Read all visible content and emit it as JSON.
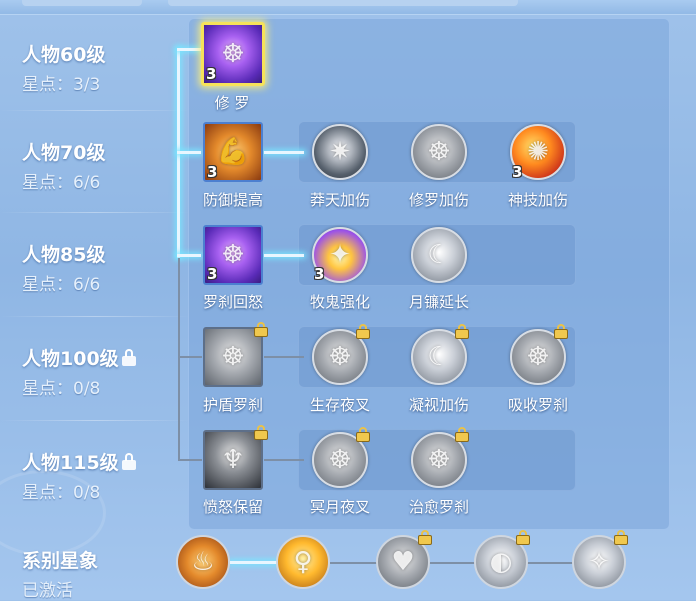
{
  "levels": [
    {
      "title": "人物60级",
      "stars": "星点：3/3",
      "locked": false
    },
    {
      "title": "人物70级",
      "stars": "星点：6/6",
      "locked": false
    },
    {
      "title": "人物85级",
      "stars": "星点：6/6",
      "locked": false
    },
    {
      "title": "人物100级",
      "stars": "星点：0/8",
      "locked": true
    },
    {
      "title": "人物115级",
      "stars": "星点：0/8",
      "locked": true
    }
  ],
  "skills": {
    "r60_main": {
      "label": "修 罗",
      "count": "3"
    },
    "r70_main": {
      "label": "防御提高",
      "count": "3"
    },
    "r70_a": {
      "label": "莽天加伤"
    },
    "r70_b": {
      "label": "修罗加伤"
    },
    "r70_c": {
      "label": "神技加伤",
      "count": "3"
    },
    "r85_main": {
      "label": "罗刹回怒",
      "count": "3"
    },
    "r85_a": {
      "label": "牧鬼强化",
      "count": "3"
    },
    "r85_b": {
      "label": "月镰延长"
    },
    "r100_main": {
      "label": "护盾罗刹"
    },
    "r100_a": {
      "label": "生存夜叉"
    },
    "r100_b": {
      "label": "凝视加伤"
    },
    "r100_c": {
      "label": "吸收罗刹"
    },
    "r115_main": {
      "label": "愤怒保留"
    },
    "r115_a": {
      "label": "冥月夜叉"
    },
    "r115_b": {
      "label": "治愈罗刹"
    }
  },
  "series": {
    "title": "系别星象",
    "status": "已激活"
  },
  "colors": {
    "active_line": "#e8f6ff",
    "gold_frame": "#f6e25a",
    "lock": "#f0c84e"
  }
}
